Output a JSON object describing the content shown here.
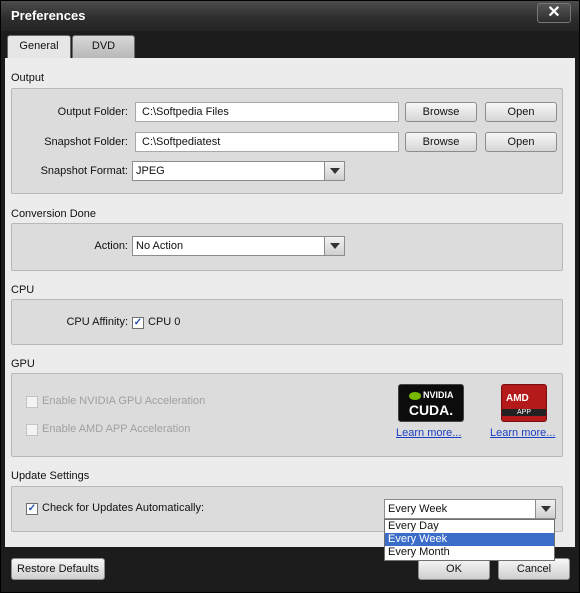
{
  "window": {
    "title": "Preferences",
    "close_glyph": "✕"
  },
  "tabs": [
    {
      "label": "General",
      "active": true
    },
    {
      "label": "DVD",
      "active": false
    }
  ],
  "output": {
    "section_label": "Output",
    "output_folder_label": "Output Folder:",
    "output_folder_value": "C:\\Softpedia Files",
    "snapshot_folder_label": "Snapshot Folder:",
    "snapshot_folder_value": "C:\\Softpediatest",
    "browse_label": "Browse",
    "open_label": "Open",
    "snapshot_format_label": "Snapshot Format:",
    "snapshot_format_value": "JPEG"
  },
  "conversion": {
    "section_label": "Conversion Done",
    "action_label": "Action:",
    "action_value": "No Action"
  },
  "cpu": {
    "section_label": "CPU",
    "affinity_label": "CPU Affinity:",
    "cpu0_label": "CPU 0",
    "cpu0_checked": true
  },
  "gpu": {
    "section_label": "GPU",
    "nvidia_label": "Enable NVIDIA GPU Acceleration",
    "amd_label": "Enable AMD APP Acceleration",
    "nvidia_logo_brand": "NVIDIA",
    "nvidia_logo_text": "CUDA.",
    "amd_logo_brand": "AMD",
    "amd_logo_text": "APP",
    "learn_more_label": "Learn more..."
  },
  "update": {
    "section_label": "Update Settings",
    "check_label": "Check for Updates Automatically:",
    "check_checked": true,
    "frequency_value": "Every Week",
    "options": [
      "Every Day",
      "Every Week",
      "Every Month"
    ],
    "selected_index": 1
  },
  "footer": {
    "restore_label": "Restore Defaults",
    "ok_label": "OK",
    "cancel_label": "Cancel"
  },
  "colors": {
    "link": "#1a3fc0",
    "selection": "#3b6cc7",
    "nvidia_green": "#76b900",
    "amd_red": "#b51a1a"
  }
}
